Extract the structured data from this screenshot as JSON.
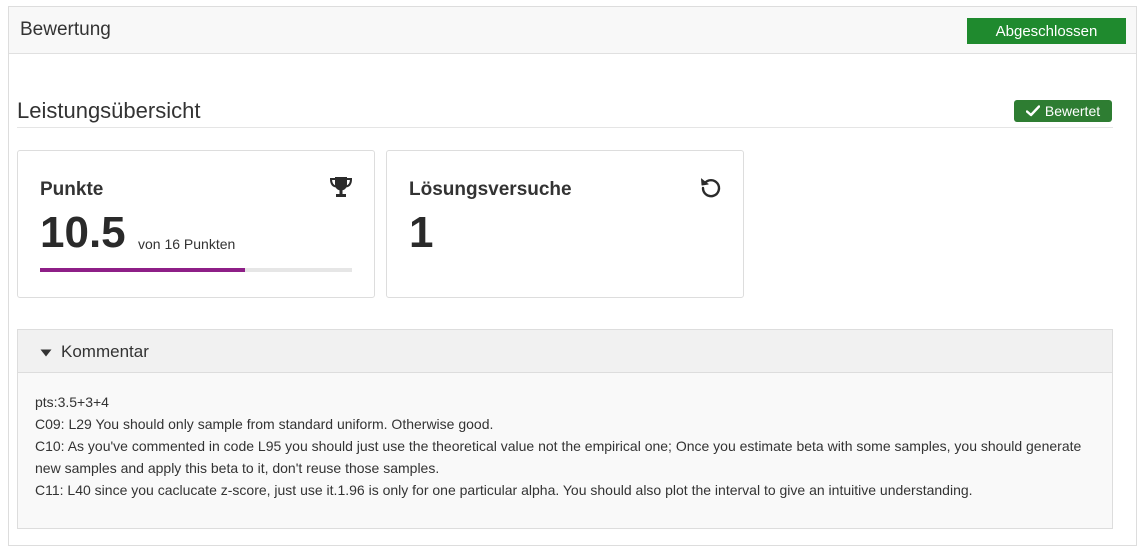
{
  "header": {
    "title": "Bewertung",
    "status_button": "Abgeschlossen"
  },
  "overview": {
    "title": "Leistungsübersicht",
    "badge": "Bewertet",
    "badge_icon": "check-icon"
  },
  "points_card": {
    "label": "Punkte",
    "icon": "trophy-icon",
    "value": "10.5",
    "of_text": "von 16 Punkten",
    "progress_fraction": 0.656
  },
  "attempts_card": {
    "label": "Lösungsversuche",
    "icon": "history-icon",
    "value": "1"
  },
  "comment": {
    "toggle_label": "Kommentar",
    "toggle_icon": "caret-down-icon",
    "lines": [
      "pts:3.5+3+4",
      "C09: L29 You should only sample from standard uniform. Otherwise good.",
      "C10: As you've commented in code L95 you should just use the theoretical value not the empirical one; Once you estimate beta with some samples, you should generate new samples and apply this beta to it, don't reuse those samples.",
      "C11: L40 since you caclucate z-score, just use it.1.96 is only for one particular alpha. You should also plot the interval to give an intuitive understanding."
    ]
  },
  "colors": {
    "status_green": "#1f8a2e",
    "badge_green": "#2e7d32",
    "progress_purple": "#8e1f87"
  }
}
